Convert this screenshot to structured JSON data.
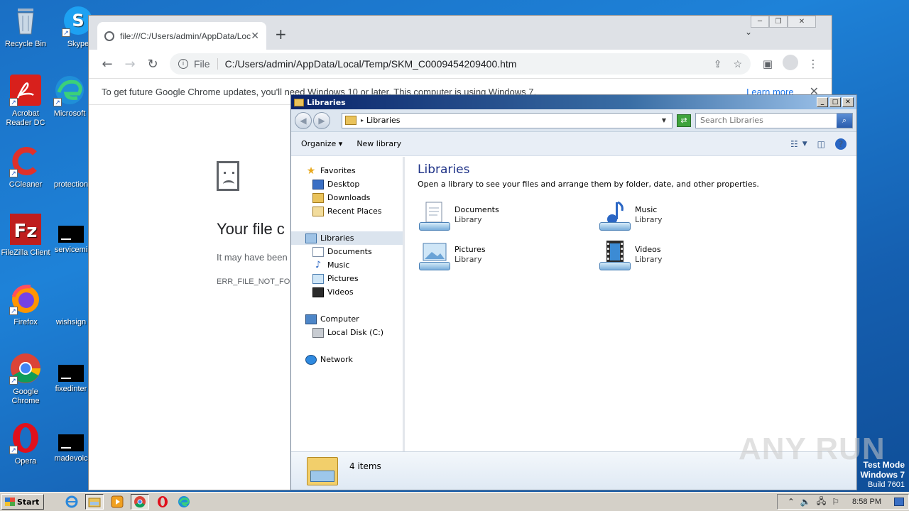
{
  "desktop": {
    "icons": [
      {
        "label": "Recycle Bin",
        "icon": "recycle-bin-icon"
      },
      {
        "label": "Skype",
        "icon": "skype-icon"
      },
      {
        "label": "Acrobat Reader DC",
        "icon": "acrobat-icon"
      },
      {
        "label": "Microsoft",
        "icon": "edge-icon"
      },
      {
        "label": "CCleaner",
        "icon": "ccleaner-icon"
      },
      {
        "label": "protection",
        "icon": "file-icon"
      },
      {
        "label": "FileZilla Client",
        "icon": "filezilla-icon"
      },
      {
        "label": "servicemi",
        "icon": "file-icon"
      },
      {
        "label": "Firefox",
        "icon": "firefox-icon"
      },
      {
        "label": "wishsign",
        "icon": "file-icon"
      },
      {
        "label": "Google Chrome",
        "icon": "chrome-icon"
      },
      {
        "label": "fixedinter",
        "icon": "file-icon"
      },
      {
        "label": "Opera",
        "icon": "opera-icon"
      },
      {
        "label": "madevoic",
        "icon": "file-icon"
      }
    ]
  },
  "chrome": {
    "tab_title": "file:///C:/Users/admin/AppData/Loca",
    "new_tab": "+",
    "omnibox_scheme": "File",
    "omnibox_url": "C:/Users/admin/AppData/Local/Temp/SKM_C0009454209400.htm",
    "infobar_message": "To get future Google Chrome updates, you'll need Windows 10 or later. This computer is using Windows 7.",
    "infobar_link": "Learn more",
    "error_title": "Your file c",
    "error_sub": "It may have been",
    "error_code": "ERR_FILE_NOT_FOU"
  },
  "explorer": {
    "title": "Libraries",
    "breadcrumb": "Libraries",
    "search_placeholder": "Search Libraries",
    "commands": {
      "organize": "Organize",
      "new_library": "New library"
    },
    "nav": {
      "favorites": "Favorites",
      "favorites_items": [
        "Desktop",
        "Downloads",
        "Recent Places"
      ],
      "libraries": "Libraries",
      "libraries_items": [
        "Documents",
        "Music",
        "Pictures",
        "Videos"
      ],
      "computer": "Computer",
      "computer_items": [
        "Local Disk (C:)"
      ],
      "network": "Network"
    },
    "heading": "Libraries",
    "description": "Open a library to see your files and arrange them by folder, date, and other properties.",
    "libraries": [
      {
        "name": "Documents",
        "kind": "Library"
      },
      {
        "name": "Music",
        "kind": "Library"
      },
      {
        "name": "Pictures",
        "kind": "Library"
      },
      {
        "name": "Videos",
        "kind": "Library"
      }
    ],
    "item_count": "4 items"
  },
  "watermark": "ANY RUN",
  "test_mode": {
    "line1": "Test Mode",
    "line2": "Windows 7",
    "line3": "Build 7601"
  },
  "taskbar": {
    "start_label": "Start",
    "clock": "8:58 PM"
  }
}
